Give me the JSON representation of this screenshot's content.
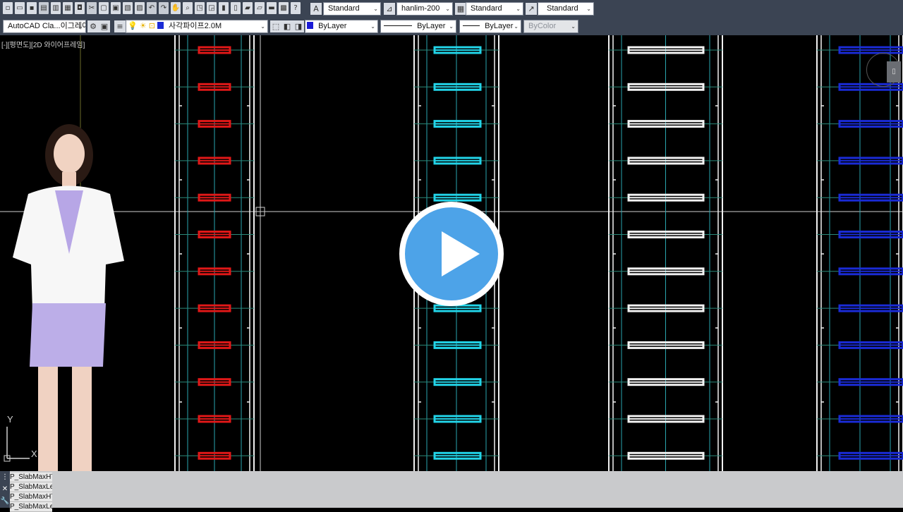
{
  "toolbar1": {
    "text_style": "Standard",
    "dim_style": "hanlim-200",
    "table_style": "Standard",
    "multileader_style": "Standard"
  },
  "toolbar2": {
    "workspace": "AutoCAD Cla...이그레이션될",
    "layer": "사각파이프2.0M",
    "color": "ByLayer",
    "linetype": "ByLayer",
    "lineweight": "ByLayer",
    "plotstyle": "ByColor",
    "layer_color": "#1a2bd6",
    "color_swatch": "#1a1ad6"
  },
  "viewport": {
    "label": "[-][평면도][2D 와이어프레임]",
    "ucs_x": "X",
    "ucs_y": "Y"
  },
  "command_history": [
    "P_SlabMaxHTy",
    "P_SlabMaxLen",
    "P_SlabMaxHTy",
    "P_SlabMaxLen"
  ],
  "colors": {
    "red_member": "#e01818",
    "cyan_member": "#22d4e8",
    "white_member": "#f2f2f2",
    "blue_member": "#1a2bd6",
    "play_button": "#4da3e8"
  }
}
